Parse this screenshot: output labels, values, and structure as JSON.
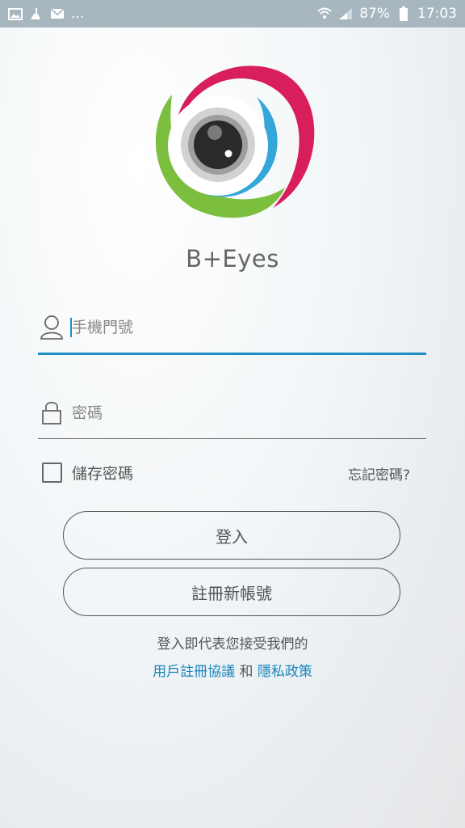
{
  "status_bar": {
    "left_icons": [
      "image-icon",
      "broom-icon",
      "mail-icon"
    ],
    "more": "...",
    "battery_percent": "87%",
    "time": "17:03"
  },
  "app": {
    "name": "B+Eyes"
  },
  "login_form": {
    "phone_placeholder": "手機門號",
    "password_placeholder": "密碼",
    "remember_label": "儲存密碼",
    "forgot_label": "忘記密碼?",
    "login_button": "登入",
    "register_button": "註冊新帳號"
  },
  "terms": {
    "prefix": "登入即代表您接受我們的",
    "user_agreement": "用戶註冊協議",
    "and": "和",
    "privacy_policy": "隱私政策"
  },
  "colors": {
    "status_bar": "#a7b6bf",
    "accent": "#1f8ec4",
    "logo_magenta": "#d81e5b",
    "logo_green": "#7cbf3f",
    "logo_blue": "#35a6d8"
  }
}
